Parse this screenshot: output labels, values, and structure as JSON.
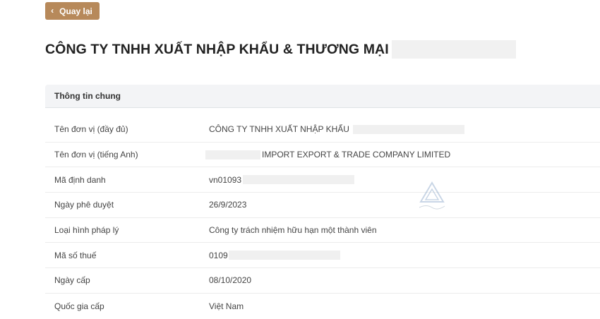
{
  "back_button": {
    "label": "Quay lại",
    "icon": "chevron-left-icon"
  },
  "page_title": "CÔNG TY TNHH XUẤT NHẬP KHẨU & THƯƠNG MẠI",
  "section": {
    "title": "Thông tin chung"
  },
  "rows": [
    {
      "label": "Tên đơn vị (đầy đủ)",
      "value": "CÔNG TY TNHH XUẤT NHẬP KHẨU"
    },
    {
      "label": "Tên đơn vị (tiếng Anh)",
      "value": "IMPORT EXPORT & TRADE COMPANY LIMITED"
    },
    {
      "label": "Mã định danh",
      "value": "vn01093"
    },
    {
      "label": "Ngày phê duyệt",
      "value": "26/9/2023"
    },
    {
      "label": "Loại hình pháp lý",
      "value": "Công ty trách nhiệm hữu hạn một thành viên"
    },
    {
      "label": "Mã số thuế",
      "value": "0109"
    },
    {
      "label": "Ngày cấp",
      "value": "08/10/2020"
    },
    {
      "label": "Quốc gia cấp",
      "value": "Việt Nam"
    }
  ],
  "colors": {
    "accent": "#b7895a",
    "section_bg": "#f3f4f6",
    "divider": "#ececec",
    "mask": "#f0f0f0"
  }
}
